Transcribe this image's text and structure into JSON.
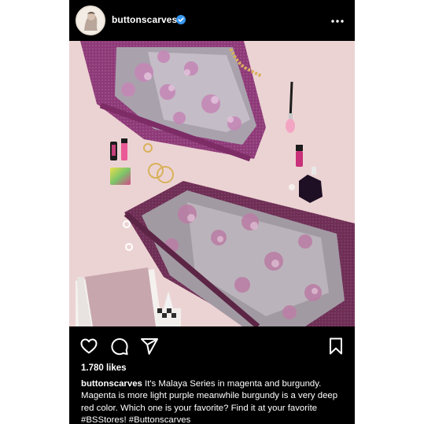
{
  "post": {
    "username": "buttonscarves",
    "verified": true,
    "likes": "1.780 likes",
    "caption_user": "buttonscarves",
    "caption_text": "It's Malaya Series in magenta and burgundy. Magenta is more light purple meanwhile burgundy is a very deep red color. Which one is your favorite? Find it at your favorite #BSStores! #Buttonscarves"
  },
  "icons": {
    "more": "more-horizontal-icon",
    "like": "heart-outline-icon",
    "comment": "comment-bubble-icon",
    "share": "paper-plane-icon",
    "save": "bookmark-outline-icon",
    "verified": "verified-badge-icon"
  },
  "colors": {
    "background": "#000000",
    "text": "#ffffff",
    "verified_blue": "#3897f0",
    "photo_backdrop": "#ecd3d3",
    "scarf_magenta": "#8e3a78",
    "scarf_burgundy": "#6e2e55"
  }
}
